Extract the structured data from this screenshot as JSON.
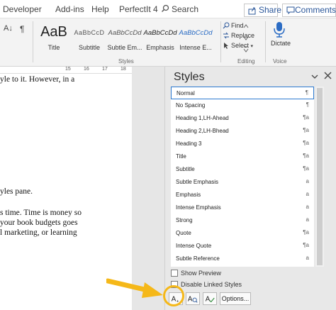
{
  "menu": {
    "items": [
      "Developer",
      "Add-ins",
      "Help",
      "PerfectIt 4"
    ],
    "search_label": "Search",
    "share_label": "Share",
    "comments_label": "Comments"
  },
  "ribbon": {
    "paragraph_partial": [
      "A↓",
      "¶"
    ],
    "styles": [
      {
        "sample": "AaB",
        "label": "Title"
      },
      {
        "sample": "AaBbCcD",
        "label": "Subtitle"
      },
      {
        "sample": "AaBbCcDd",
        "label": "Subtle Em..."
      },
      {
        "sample": "AaBbCcDd",
        "label": "Emphasis"
      },
      {
        "sample": "AaBbCcDd",
        "label": "Intense E..."
      }
    ],
    "styles_group_label": "Styles",
    "editing": {
      "find": "Find",
      "replace": "Replace",
      "select": "Select"
    },
    "editing_group_label": "Editing",
    "dictate_label": "Dictate",
    "voice_group_label": "Voice"
  },
  "document": {
    "ruler_numbers": [
      "15",
      "16",
      "17",
      "18"
    ],
    "lines": [
      "yle to it. However, in a",
      "yles pane.",
      "s time. Time is money so",
      "your book budgets goes",
      "l marketing, or learning"
    ]
  },
  "styles_pane": {
    "title": "Styles",
    "items": [
      {
        "label": "Normal",
        "type": "¶",
        "selected": true
      },
      {
        "label": "No Spacing",
        "type": "¶"
      },
      {
        "label": "Heading 1,LH-Ahead",
        "type": "¶a"
      },
      {
        "label": "Heading 2,LH-Bhead",
        "type": "¶a"
      },
      {
        "label": "Heading 3",
        "type": "¶a"
      },
      {
        "label": "Title",
        "type": "¶a"
      },
      {
        "label": "Subtitle",
        "type": "¶a"
      },
      {
        "label": "Subtle Emphasis",
        "type": "a"
      },
      {
        "label": "Emphasis",
        "type": "a"
      },
      {
        "label": "Intense Emphasis",
        "type": "a"
      },
      {
        "label": "Strong",
        "type": "a"
      },
      {
        "label": "Quote",
        "type": "¶a"
      },
      {
        "label": "Intense Quote",
        "type": "¶a"
      },
      {
        "label": "Subtle Reference",
        "type": "a"
      }
    ],
    "show_preview_label": "Show Preview",
    "disable_linked_label": "Disable Linked Styles",
    "options_label": "Options..."
  },
  "colors": {
    "accent": "#2b579a",
    "highlight": "#f5b819",
    "selection_border": "#2b79d0"
  }
}
